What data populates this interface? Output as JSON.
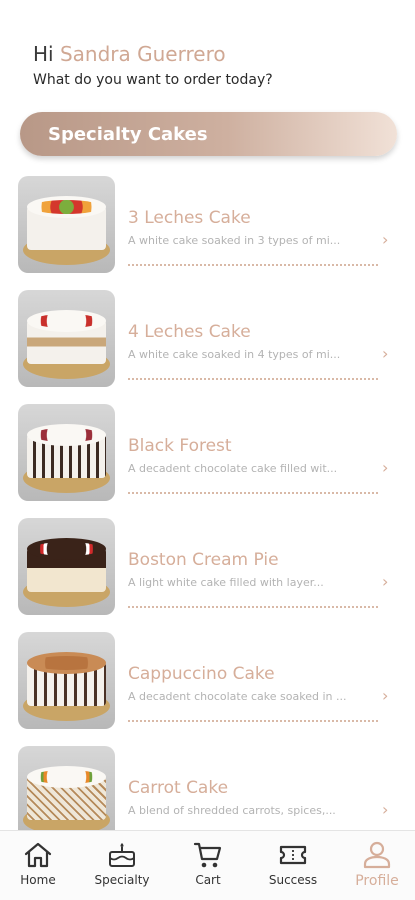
{
  "greeting": {
    "hi": "Hi",
    "name": "Sandra Guerrero",
    "subtitle": "What do you want to order today?"
  },
  "section": {
    "title": "Specialty Cakes"
  },
  "cakes": [
    {
      "name": "3 Leches Cake",
      "description": "A white cake soaked in 3 types of mi..."
    },
    {
      "name": "4 Leches Cake",
      "description": "A white cake soaked in 4 types of mi..."
    },
    {
      "name": "Black Forest",
      "description": "A decadent chocolate cake filled wit..."
    },
    {
      "name": "Boston Cream Pie",
      "description": "A light white cake filled with layer..."
    },
    {
      "name": "Cappuccino Cake",
      "description": "A decadent chocolate cake soaked in ..."
    },
    {
      "name": "Carrot Cake",
      "description": "A blend of shredded carrots, spices,..."
    }
  ],
  "tabs": [
    {
      "label": "Home",
      "icon": "home-icon"
    },
    {
      "label": "Specialty",
      "icon": "cake-icon"
    },
    {
      "label": "Cart",
      "icon": "cart-icon"
    },
    {
      "label": "Success",
      "icon": "ticket-icon"
    },
    {
      "label": "Profile",
      "icon": "profile-icon",
      "active": true
    }
  ],
  "colors": {
    "accent": "#d6ae9a",
    "banner_start": "#b89887",
    "banner_end": "#f1e1d7"
  }
}
